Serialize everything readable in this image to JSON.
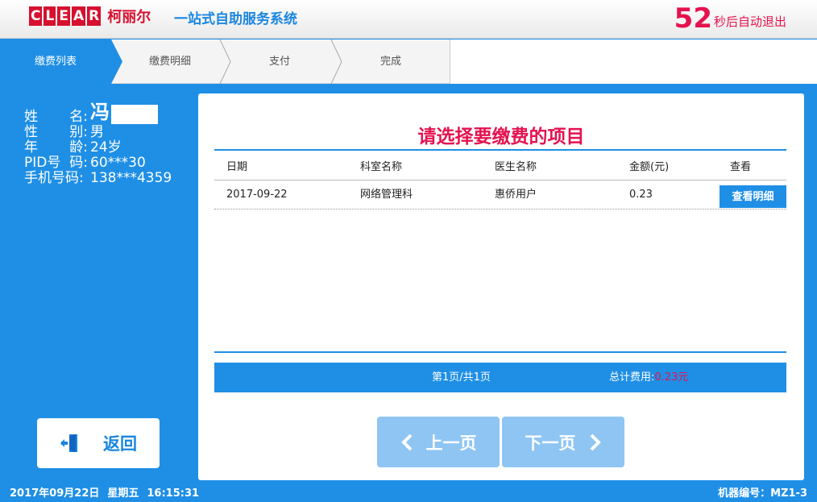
{
  "header": {
    "logo_letters": [
      "C",
      "L",
      "E",
      "A",
      "R"
    ],
    "logo_cn": "柯丽尔",
    "system_title": "一站式自助服务系统",
    "countdown_value": "52",
    "countdown_text": "秒后自动退出"
  },
  "steps": [
    {
      "label": "缴费列表",
      "active": true
    },
    {
      "label": "缴费明细",
      "active": false
    },
    {
      "label": "支付",
      "active": false
    },
    {
      "label": "完成",
      "active": false
    }
  ],
  "patient": {
    "name_label": [
      "姓",
      "名"
    ],
    "name_value": "冯",
    "gender_label": [
      "性",
      "别"
    ],
    "gender_value": "男",
    "age_label": [
      "年",
      "龄"
    ],
    "age_value": "24岁",
    "pid_label": [
      "PID号",
      "码"
    ],
    "pid_value": "60***30",
    "phone_label": "手机号码",
    "phone_value": "138***4359",
    "separator": ":"
  },
  "back_button": {
    "label": "返回",
    "icon": "exit-door-icon"
  },
  "main": {
    "title": "请选择要缴费的项目",
    "columns": [
      "日期",
      "科室名称",
      "医生名称",
      "金额(元)",
      "查看"
    ],
    "rows": [
      {
        "date": "2017-09-22",
        "department": "网络管理科",
        "doctor": "惠侨用户",
        "amount": "0.23",
        "action": "查看明细"
      }
    ],
    "page_info": "第1页/共1页",
    "total_label": "总计费用:",
    "total_amount": "0.23元",
    "prev_label": "上一页",
    "next_label": "下一页"
  },
  "footer": {
    "date": "2017年09月22日",
    "weekday": "星期五",
    "time": "16:15:31",
    "machine": "机器编号：MZ1-3"
  },
  "colors": {
    "primary": "#1f8fe6",
    "accent_red": "#e5124f",
    "logo_red": "#d7102f",
    "disabled_button": "#8fc5f3"
  }
}
